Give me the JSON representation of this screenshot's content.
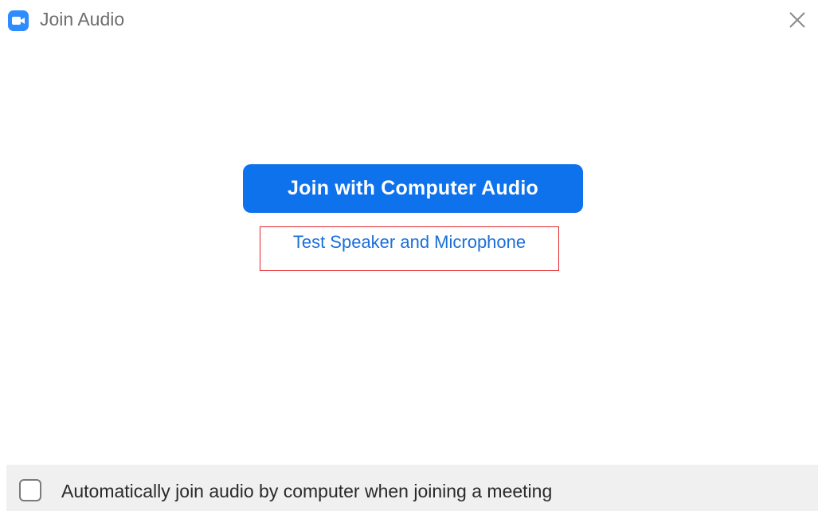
{
  "window": {
    "title": "Join Audio",
    "app_icon": "camera-icon",
    "close_icon": "close-icon"
  },
  "main": {
    "join_button_label": "Join with Computer Audio",
    "test_link_label": "Test Speaker and Microphone"
  },
  "footer": {
    "auto_join_checkbox_label": "Automatically join audio by computer when joining a meeting",
    "auto_join_checked": false
  },
  "colors": {
    "accent": "#0e72ed",
    "link": "#1a6fd8",
    "highlight_box": "#e3262b",
    "footer_bg": "#f0f0f0"
  }
}
